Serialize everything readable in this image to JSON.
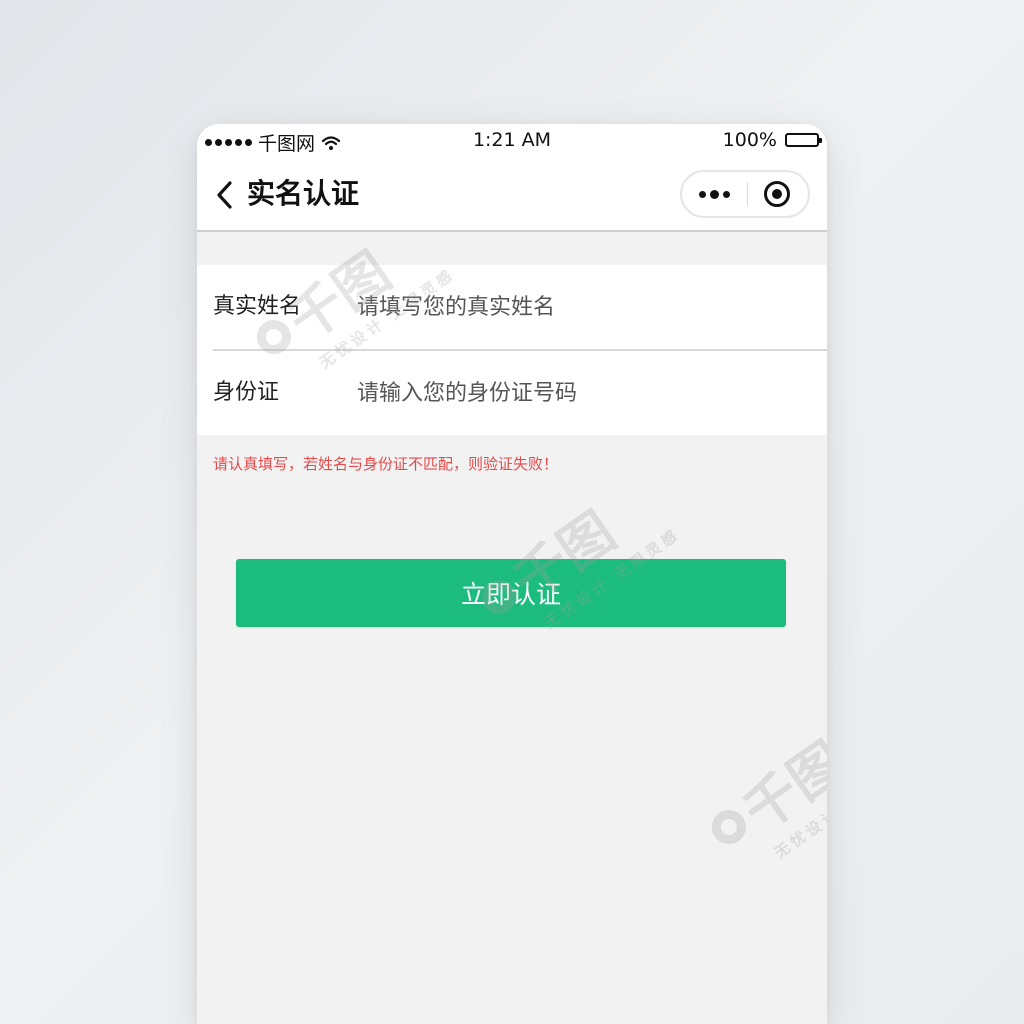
{
  "statusbar": {
    "carrier": "千图网",
    "time": "1:21 AM",
    "battery": "100%"
  },
  "navbar": {
    "title": "实名认证"
  },
  "form": {
    "name_label": "真实姓名",
    "name_placeholder": "请填写您的真实姓名",
    "name_value": "",
    "id_label": "身份证",
    "id_placeholder": "请输入您的身份证号码",
    "id_value": ""
  },
  "warning": "请认真填写，若姓名与身份证不匹配，则验证失败！",
  "submit_label": "立即认证",
  "watermark": {
    "logo": "千图",
    "tagline": "无忧设计 无限灵感"
  },
  "colors": {
    "accent_green": "#1bbc7d",
    "warning_red": "#e64b4b",
    "background": "#f2f2f2"
  }
}
